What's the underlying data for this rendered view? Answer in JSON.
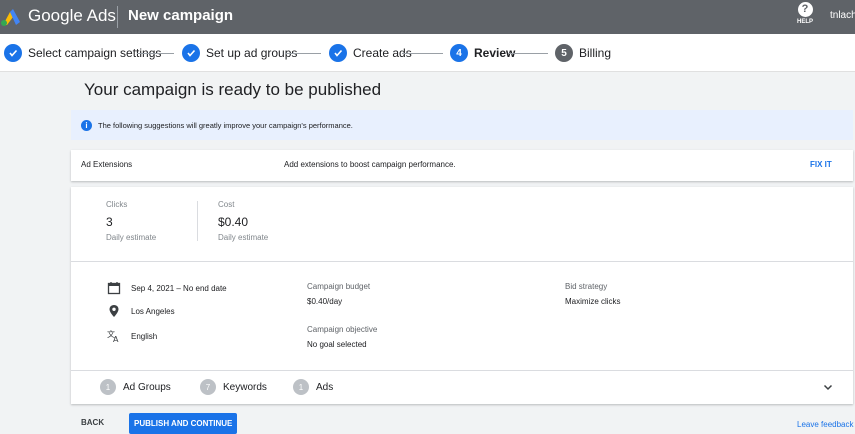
{
  "header": {
    "brand": "Google Ads",
    "title": "New campaign",
    "help_label": "HELP",
    "help_glyph": "?",
    "account": "tnlachi"
  },
  "stepper": {
    "steps": [
      {
        "label": "Select campaign settings",
        "state": "done"
      },
      {
        "label": "Set up ad groups",
        "state": "done"
      },
      {
        "label": "Create ads",
        "state": "done"
      },
      {
        "label": "Review",
        "number": "4",
        "state": "active"
      },
      {
        "label": "Billing",
        "number": "5",
        "state": "pending"
      }
    ]
  },
  "main": {
    "headline": "Your campaign is ready to be published",
    "banner": {
      "icon": "info-icon",
      "text": "The following suggestions will greatly improve your campaign's performance."
    },
    "extensions": {
      "name": "Ad Extensions",
      "description": "Add extensions to boost campaign performance.",
      "action": "FIX IT"
    },
    "summary": {
      "stats": [
        {
          "label": "Clicks",
          "value": "3",
          "sub": "Daily estimate"
        },
        {
          "label": "Cost",
          "value": "$0.40",
          "sub": "Daily estimate"
        }
      ],
      "details": [
        {
          "icon": "calendar-icon",
          "text": "Sep 4, 2021 – No end date"
        },
        {
          "icon": "location-pin-icon",
          "text": "Los Angeles"
        },
        {
          "icon": "translate-icon",
          "text": "English"
        }
      ],
      "budget": {
        "label": "Campaign budget",
        "value": "$0.40/day"
      },
      "objective": {
        "label": "Campaign objective",
        "value": "No goal selected"
      },
      "bid": {
        "label": "Bid strategy",
        "value": "Maximize clicks"
      },
      "counts": [
        {
          "count": "1",
          "label": "Ad Groups"
        },
        {
          "count": "7",
          "label": "Keywords"
        },
        {
          "count": "1",
          "label": "Ads"
        }
      ]
    }
  },
  "footer": {
    "back": "BACK",
    "publish": "PUBLISH AND CONTINUE",
    "feedback": "Leave feedback"
  },
  "colors": {
    "appbar": "#5f6368",
    "accent": "#1a73e8",
    "banner": "#e8f0fe",
    "background": "#f1f3f4"
  }
}
